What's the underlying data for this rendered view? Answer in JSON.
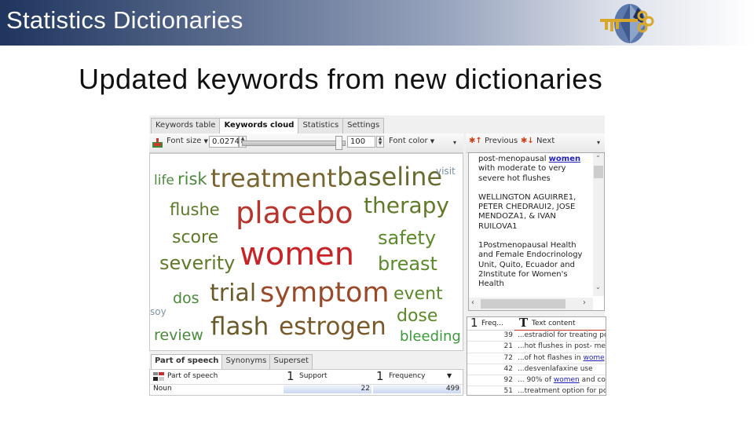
{
  "header": {
    "title": "Statistics Dictionaries",
    "logo_icon": "globe-key-logo-icon"
  },
  "slide": {
    "title": "Updated keywords from new dictionaries"
  },
  "app": {
    "tabs": [
      {
        "label": "Keywords table",
        "active": false
      },
      {
        "label": "Keywords cloud",
        "active": true
      },
      {
        "label": "Statistics",
        "active": false
      },
      {
        "label": "Settings",
        "active": false
      }
    ],
    "toolbar": {
      "font_size_label": "Font size",
      "font_size_min": "0.02740",
      "font_size_max": "100",
      "font_color_label": "Font color"
    },
    "cloud": {
      "words": [
        {
          "text": "life",
          "color": "#4a8a3a"
        },
        {
          "text": "risk",
          "color": "#4a8a3a"
        },
        {
          "text": "treatment",
          "color": "#7a6430"
        },
        {
          "text": "baseline",
          "color": "#6b6a30"
        },
        {
          "text": "visit",
          "color": "#7a93a6"
        },
        {
          "text": "flushe",
          "color": "#5a7a2a"
        },
        {
          "text": "placebo",
          "color": "#b8342c"
        },
        {
          "text": "therapy",
          "color": "#607a2a"
        },
        {
          "text": "score",
          "color": "#5a7a2a"
        },
        {
          "text": "safety",
          "color": "#5a8a2a"
        },
        {
          "text": "severity",
          "color": "#5f7a2a"
        },
        {
          "text": "women",
          "color": "#c82428"
        },
        {
          "text": "breast",
          "color": "#5a8a2a"
        },
        {
          "text": "dos",
          "color": "#4a8a3a"
        },
        {
          "text": "trial",
          "color": "#6b5a2a"
        },
        {
          "text": "symptom",
          "color": "#9a4a28"
        },
        {
          "text": "event",
          "color": "#5a8a2a"
        },
        {
          "text": "soy",
          "color": "#7a93a6"
        },
        {
          "text": "dose",
          "color": "#5a8a2a"
        },
        {
          "text": "review",
          "color": "#4a8a3a"
        },
        {
          "text": "flash",
          "color": "#6b5a2a"
        },
        {
          "text": "estrogen",
          "color": "#7a5a2a"
        },
        {
          "text": "bleeding",
          "color": "#3a9a3a"
        }
      ]
    },
    "navigator": {
      "previous_label": "Previous",
      "next_label": "Next"
    },
    "document": {
      "line1_pre": "post-menopausal ",
      "line1_hl": "women",
      "line1_post": " with moderate to very severe hot flushes",
      "authors": "WELLINGTON AGUIRRE1, PETER CHEDRAUI2, JOSE MENDOZA1, & IVAN RUILOVA1",
      "affiliation": "1Postmenopausal Health and Female Endocrinology Unit, Quito, Ecuador and 2Institute for Women's Health"
    },
    "kw_table": {
      "col_freq": "Freq...",
      "col_text": "Text content",
      "rows": [
        {
          "freq": "39",
          "pre": "...estradiol for treating po",
          "link": "",
          "post": ""
        },
        {
          "freq": "21",
          "pre": "...hot flushes in post-    me",
          "link": "",
          "post": ""
        },
        {
          "freq": "72",
          "pre": "...of hot    flashes in ",
          "link": "wome",
          "post": ""
        },
        {
          "freq": "42",
          "pre": "...desvenlafaxine      use",
          "link": "",
          "post": ""
        },
        {
          "freq": "92",
          "pre": "... 90% of ",
          "link": "women",
          "post": " and co"
        },
        {
          "freq": "51",
          "pre": "...treatment option for po",
          "link": "",
          "post": ""
        }
      ]
    },
    "bottom_tabs": [
      {
        "label": "Part of speech",
        "active": true
      },
      {
        "label": "Synonyms",
        "active": false
      },
      {
        "label": "Superset",
        "active": false
      }
    ],
    "pos_table": {
      "col_pos": "Part of speech",
      "col_support": "Support",
      "col_frequency": "Frequency",
      "rows": [
        {
          "pos": "Noun",
          "support": "22",
          "frequency": "499"
        }
      ]
    }
  }
}
